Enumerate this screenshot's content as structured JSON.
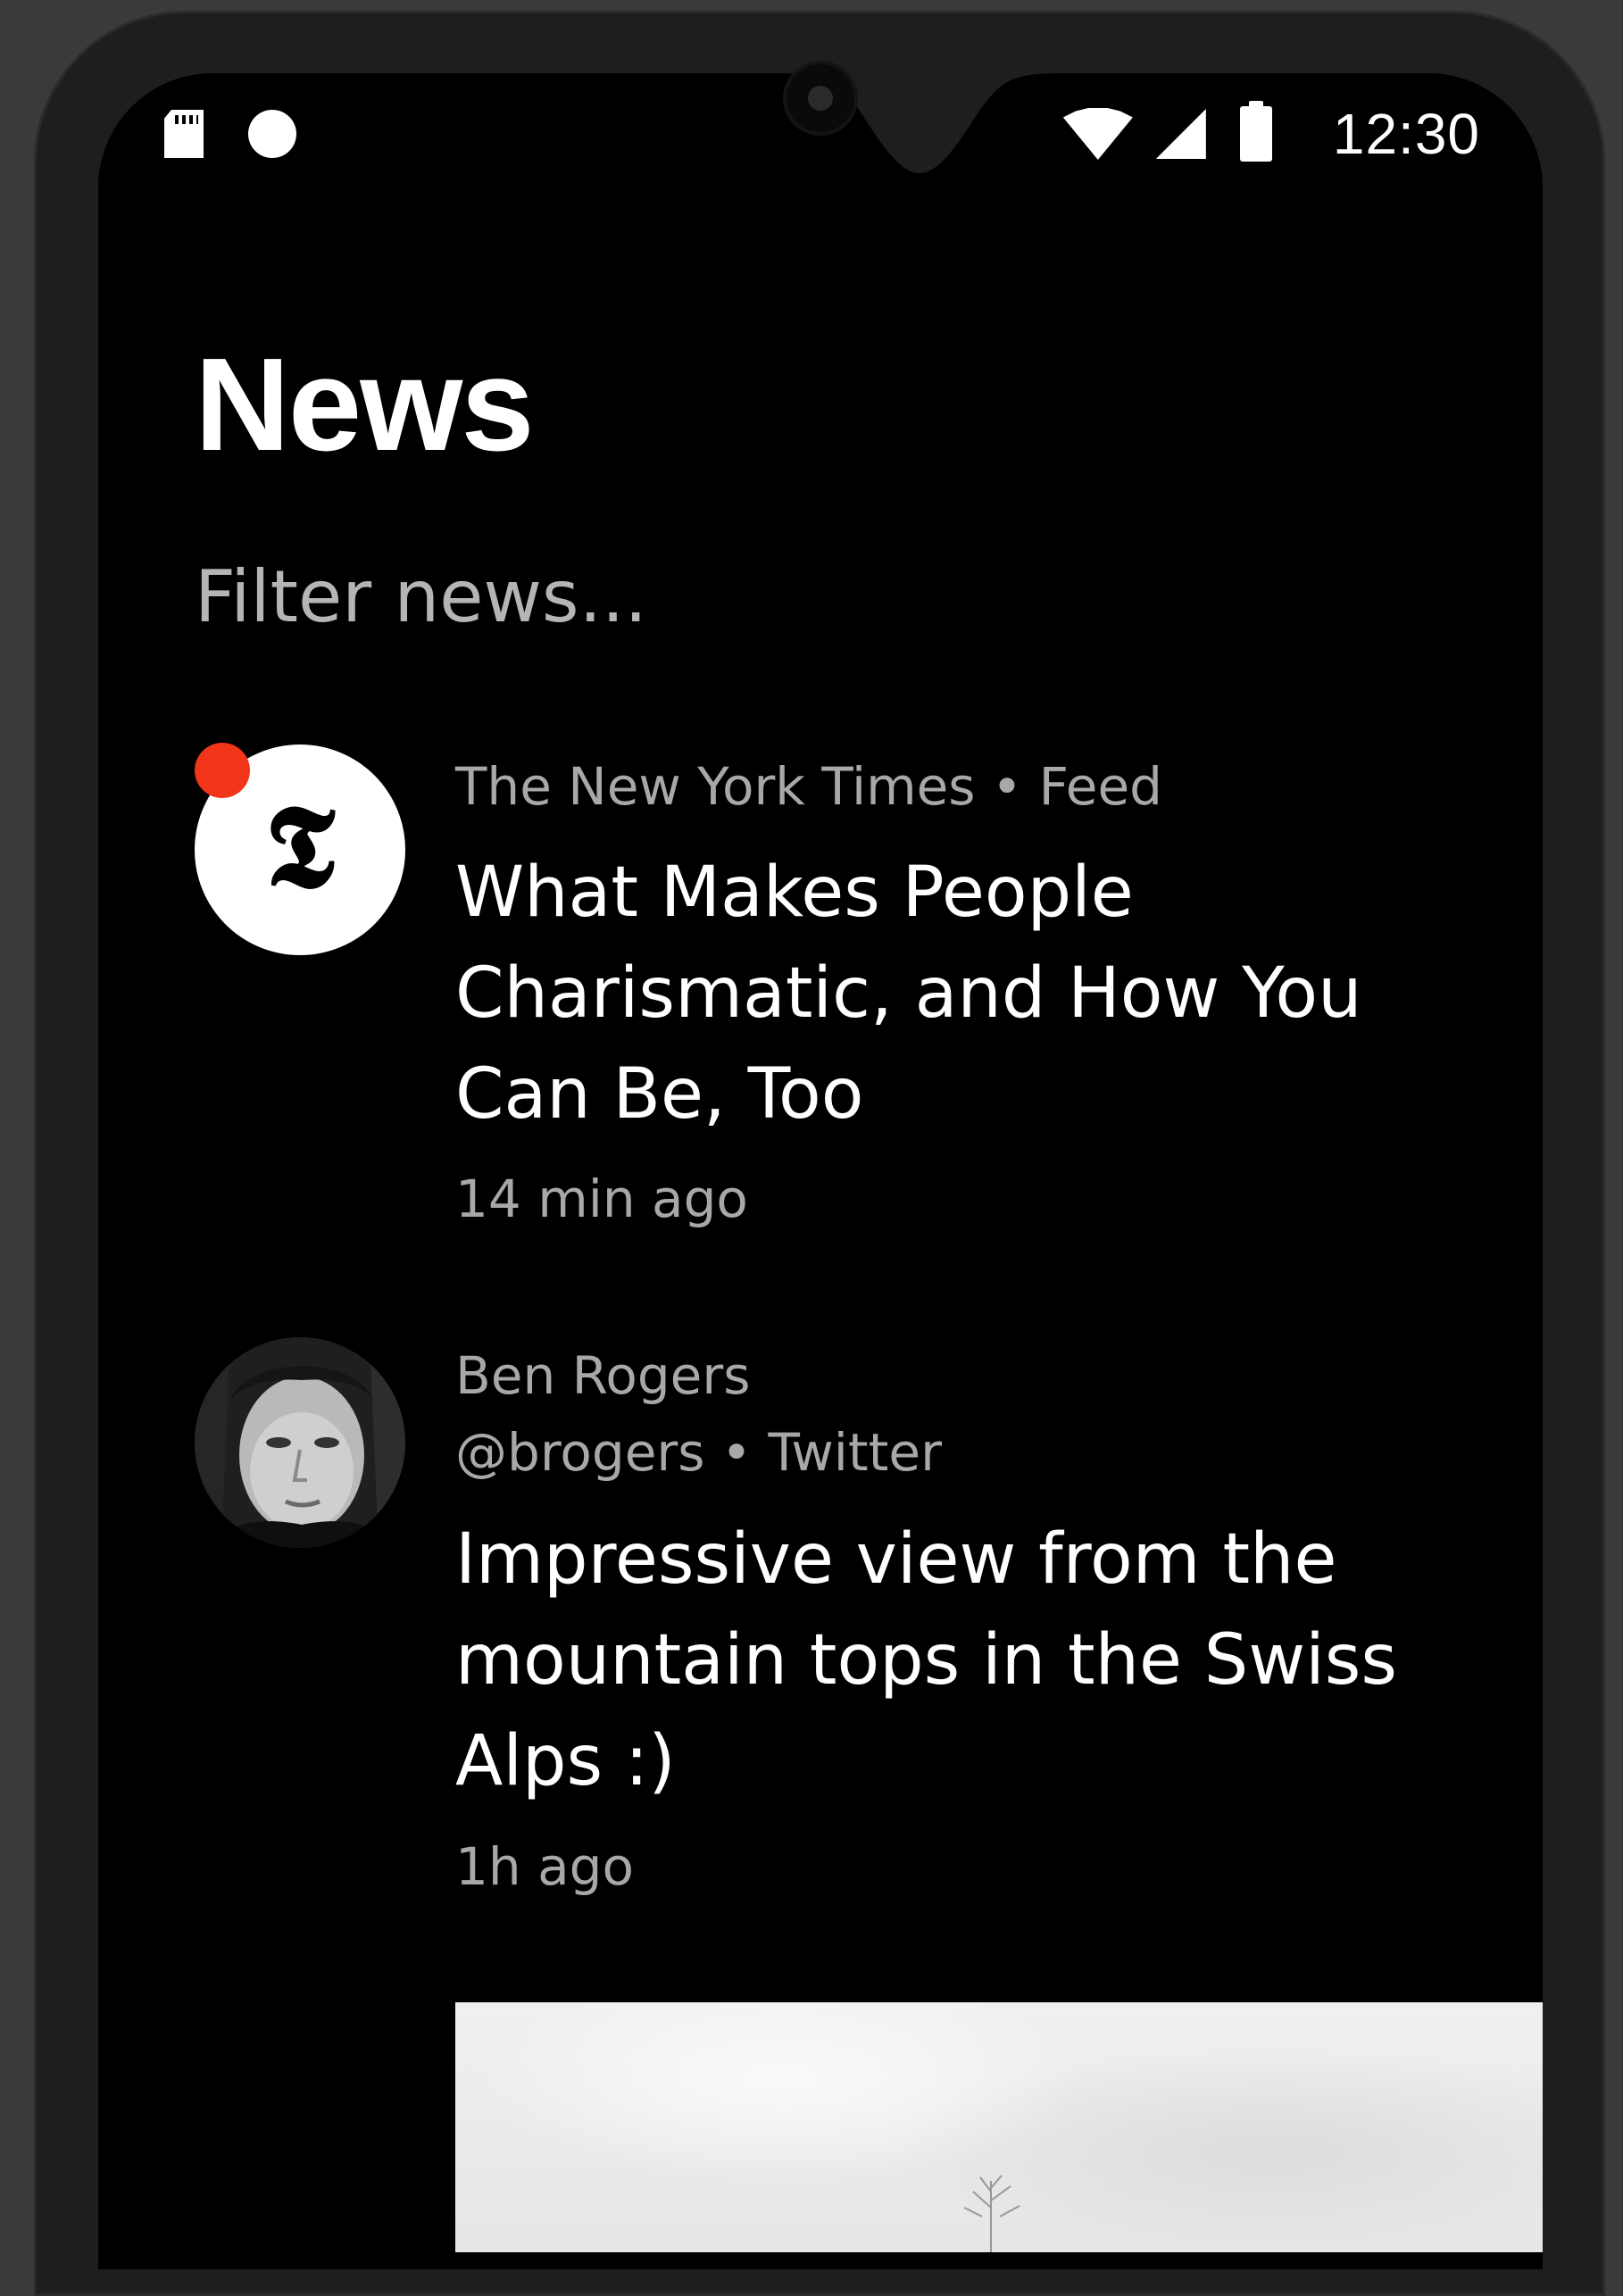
{
  "status_bar": {
    "left_icons": [
      "sd-card-icon",
      "circle-notification-icon"
    ],
    "right_icons": [
      "wifi-icon",
      "cell-signal-icon",
      "battery-icon"
    ],
    "time": "12:30"
  },
  "header": {
    "title": "News"
  },
  "filter": {
    "placeholder": "Filter news..."
  },
  "feed": {
    "items": [
      {
        "source": "The New York Times • Feed",
        "headline": "What Makes People Charismatic, and How You Can Be, Too",
        "time": "14 min ago",
        "avatar_icon": "nyt-logo-icon",
        "avatar_glyph": "𝕿",
        "unread": true,
        "unread_color": "#f23418"
      },
      {
        "author": "Ben Rogers",
        "handle_line": "@brogers • Twitter",
        "headline": "Impressive view from the mountain tops in the Swiss Alps :)",
        "time": "1h ago",
        "avatar_icon": "user-avatar-photo",
        "has_image": true
      }
    ]
  },
  "colors": {
    "background": "#000000",
    "text_primary": "#ffffff",
    "text_secondary": "#a8a8a8",
    "accent_unread": "#f23418"
  }
}
